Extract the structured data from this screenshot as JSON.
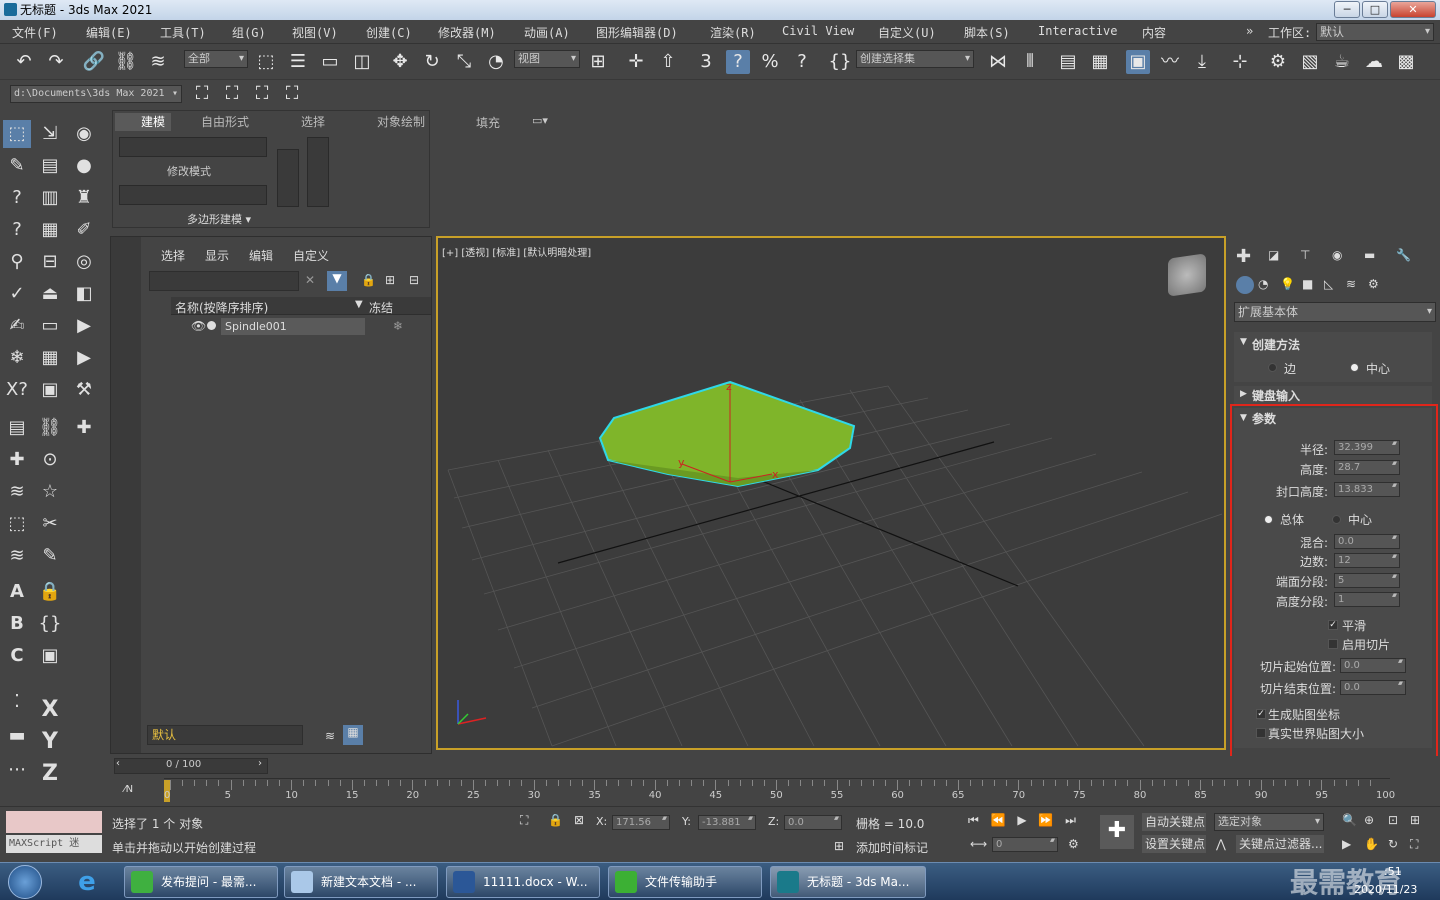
{
  "window": {
    "title": "无标题 - 3ds Max 2021",
    "min": "─",
    "max": "□",
    "close": "✕"
  },
  "menu": [
    "文件(F)",
    "编辑(E)",
    "工具(T)",
    "组(G)",
    "视图(V)",
    "创建(C)",
    "修改器(M)",
    "动画(A)",
    "图形编辑器(D)",
    "渲染(R)",
    "Civil View",
    "自定义(U)",
    "脚本(S)",
    "Interactive",
    "内容"
  ],
  "workspace": {
    "chevron": "»",
    "label": "工作区:",
    "value": "默认"
  },
  "toolbar": {
    "filter_value": "全部",
    "refcoord_value": "视图",
    "named_selection": "创建选择集",
    "snap_label": "3",
    "snap_angle": "?",
    "spinner_snap": "?"
  },
  "toolbar2": {
    "project_path": "d:\\Documents\\3ds Max 2021"
  },
  "ribbon": {
    "tabs": [
      "建模",
      "自由形式",
      "选择",
      "对象绘制",
      "填充"
    ],
    "modify_mode": "修改模式",
    "poly_modeling": "多边形建模 ▾"
  },
  "scene": {
    "tabs": [
      "选择",
      "显示",
      "编辑",
      "自定义"
    ],
    "col_name": "名称(按降序排序)",
    "col_freeze": "冻结",
    "item": "Spindle001",
    "layer": "默认"
  },
  "viewport": {
    "label": "[+] [透视] [标准] [默认明暗处理]",
    "axis_z": "z",
    "axis_y": "y",
    "axis_x": "x"
  },
  "cmd": {
    "dropdown": "扩展基本体",
    "creation_method": "创建方法",
    "edge": "边",
    "center": "中心",
    "keyboard_entry": "键盘输入",
    "params": "参数",
    "radius_label": "半径:",
    "radius": "32.399",
    "height_label": "高度:",
    "height": "28.7",
    "cap_label": "封口高度:",
    "cap": "13.833",
    "overall": "总体",
    "center2": "中心",
    "blend_label": "混合:",
    "blend": "0.0",
    "sides_label": "边数:",
    "sides": "12",
    "capseg_label": "端面分段:",
    "capseg": "5",
    "heightseg_label": "高度分段:",
    "heightseg": "1",
    "smooth": "平滑",
    "slice_on": "启用切片",
    "slice_from_label": "切片起始位置:",
    "slice_from": "0.0",
    "slice_to_label": "切片结束位置:",
    "slice_to": "0.0",
    "gen_map": "生成贴图坐标",
    "real_world": "真实世界贴图大小"
  },
  "timeline": {
    "frame": "0 / 100",
    "ticks": [
      "0",
      "5",
      "10",
      "15",
      "20",
      "25",
      "30",
      "35",
      "40",
      "45",
      "50",
      "55",
      "60",
      "65",
      "70",
      "75",
      "80",
      "85",
      "90",
      "95",
      "100"
    ]
  },
  "status": {
    "maxscript": "MAXScript 迷",
    "selected": "选择了 1 个 对象",
    "prompt": "单击并拖动以开始创建过程",
    "x_label": "X:",
    "x": "171.56",
    "y_label": "Y:",
    "y": "-13.881",
    "z_label": "Z:",
    "z": "0.0",
    "grid": "栅格 = 10.0",
    "add_time_tag": "添加时间标记",
    "auto_key": "自动关键点",
    "selected_obj": "选定对象",
    "set_key": "设置关键点",
    "key_filters": "关键点过滤器...",
    "frame_value": "0"
  },
  "taskbar": {
    "items": [
      "发布提问 - 最需...",
      "新建文本文档 - ...",
      "11111.docx - W...",
      "文件传输助手",
      "无标题 - 3ds Ma..."
    ],
    "time": ":51",
    "date": "2020/11/23",
    "watermark": "最需教育"
  },
  "colors": {
    "accent": "#c8a028",
    "highlight": "#e0261b",
    "object": "#7fb52a",
    "selection": "#2fd8e8"
  }
}
